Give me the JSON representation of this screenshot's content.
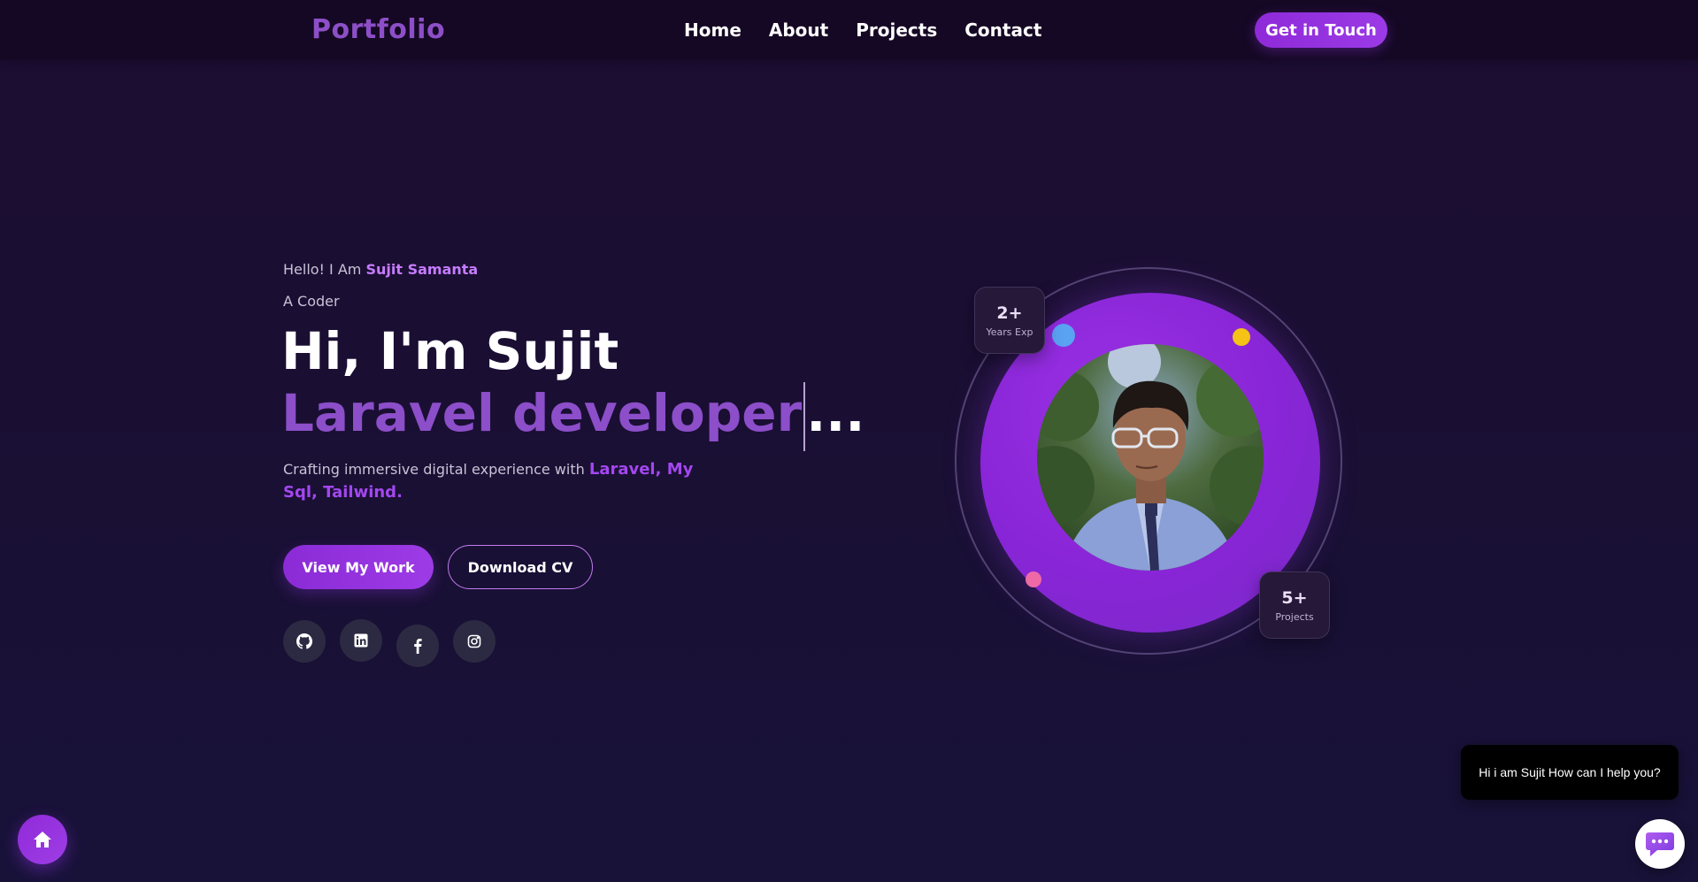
{
  "nav": {
    "logo": "Portfolio",
    "links": [
      "Home",
      "About",
      "Projects",
      "Contact"
    ],
    "cta": "Get in Touch"
  },
  "hero": {
    "greeting_prefix": "Hello! I Am",
    "greeting_name": "Sujit Samanta",
    "role": "A Coder",
    "headline": "Hi, I'm Sujit",
    "typed_text": "Laravel developer",
    "typed_suffix": "...",
    "description_prefix": "Crafting immersive digital experience with",
    "description_tech": "Laravel, My Sql, Tailwind.",
    "primary_button": "View My Work",
    "secondary_button": "Download CV",
    "socials": [
      "github-icon",
      "linkedin-icon",
      "facebook-icon",
      "instagram-icon"
    ]
  },
  "stats": {
    "experience": {
      "value": "2+",
      "label": "Years Exp"
    },
    "projects": {
      "value": "5+",
      "label": "Projects"
    }
  },
  "chat": {
    "message": "Hi i am Sujit How can I help you?"
  },
  "colors": {
    "accent": "#9333ea",
    "accent_light": "#c67cff",
    "background": "#1a0f33",
    "dot_blue": "#5aa2f2",
    "dot_yellow": "#f5c216",
    "dot_pink": "#ee6aa7"
  }
}
